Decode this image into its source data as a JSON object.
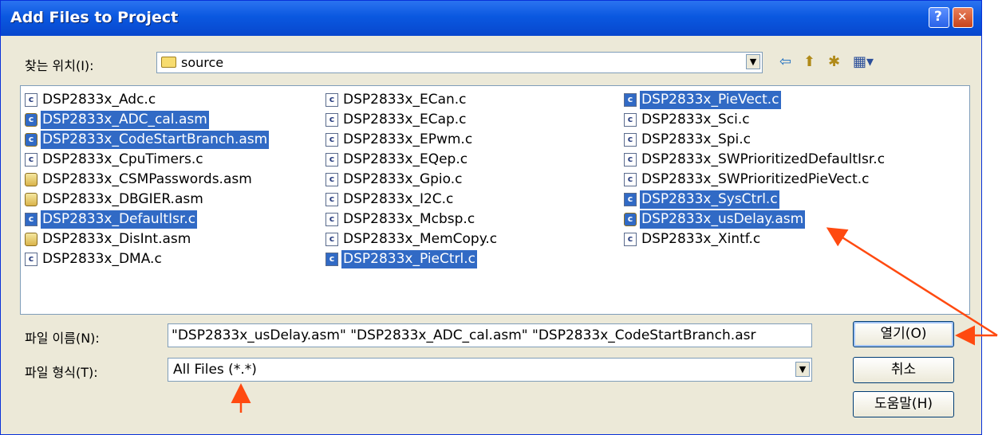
{
  "window": {
    "title": "Add Files to Project",
    "help_button": "?",
    "close_button": "✕"
  },
  "lookin": {
    "label": "찾는 위치(I):",
    "value": "source"
  },
  "toolbar": {
    "back_icon": "⇦",
    "up_icon": "⬆",
    "new_folder_icon": "✱",
    "view_icon": "▦▾"
  },
  "files": [
    {
      "name": "DSP2833x_Adc.c",
      "type": "c",
      "selected": false
    },
    {
      "name": "DSP2833x_ADC_cal.asm",
      "type": "asm",
      "selected": true
    },
    {
      "name": "DSP2833x_CodeStartBranch.asm",
      "type": "asm",
      "selected": true
    },
    {
      "name": "DSP2833x_CpuTimers.c",
      "type": "c",
      "selected": false
    },
    {
      "name": "DSP2833x_CSMPasswords.asm",
      "type": "asm",
      "selected": false
    },
    {
      "name": "DSP2833x_DBGIER.asm",
      "type": "asm",
      "selected": false
    },
    {
      "name": "DSP2833x_DefaultIsr.c",
      "type": "c",
      "selected": true
    },
    {
      "name": "DSP2833x_DisInt.asm",
      "type": "asm",
      "selected": false
    },
    {
      "name": "DSP2833x_DMA.c",
      "type": "c",
      "selected": false
    },
    {
      "name": "DSP2833x_ECan.c",
      "type": "c",
      "selected": false
    },
    {
      "name": "DSP2833x_ECap.c",
      "type": "c",
      "selected": false
    },
    {
      "name": "DSP2833x_EPwm.c",
      "type": "c",
      "selected": false
    },
    {
      "name": "DSP2833x_EQep.c",
      "type": "c",
      "selected": false
    },
    {
      "name": "DSP2833x_Gpio.c",
      "type": "c",
      "selected": false
    },
    {
      "name": "DSP2833x_I2C.c",
      "type": "c",
      "selected": false
    },
    {
      "name": "DSP2833x_Mcbsp.c",
      "type": "c",
      "selected": false
    },
    {
      "name": "DSP2833x_MemCopy.c",
      "type": "c",
      "selected": false
    },
    {
      "name": "DSP2833x_PieCtrl.c",
      "type": "c",
      "selected": true
    },
    {
      "name": "DSP2833x_PieVect.c",
      "type": "c",
      "selected": true
    },
    {
      "name": "DSP2833x_Sci.c",
      "type": "c",
      "selected": false
    },
    {
      "name": "DSP2833x_Spi.c",
      "type": "c",
      "selected": false
    },
    {
      "name": "DSP2833x_SWPrioritizedDefaultIsr.c",
      "type": "c",
      "selected": false
    },
    {
      "name": "DSP2833x_SWPrioritizedPieVect.c",
      "type": "c",
      "selected": false
    },
    {
      "name": "DSP2833x_SysCtrl.c",
      "type": "c",
      "selected": true
    },
    {
      "name": "DSP2833x_usDelay.asm",
      "type": "asm",
      "selected": true
    },
    {
      "name": "DSP2833x_Xintf.c",
      "type": "c",
      "selected": false
    }
  ],
  "filename": {
    "label": "파일 이름(N):",
    "value": "\"DSP2833x_usDelay.asm\" \"DSP2833x_ADC_cal.asm\" \"DSP2833x_CodeStartBranch.asr"
  },
  "filetype": {
    "label": "파일 형식(T):",
    "value": "All Files (*.*)"
  },
  "buttons": {
    "open": "열기(O)",
    "cancel": "취소",
    "help": "도움말(H)"
  },
  "colors": {
    "selection": "#316ac5",
    "annotation_arrow": "#ff4a10",
    "titlebar": "#0a58e0"
  }
}
